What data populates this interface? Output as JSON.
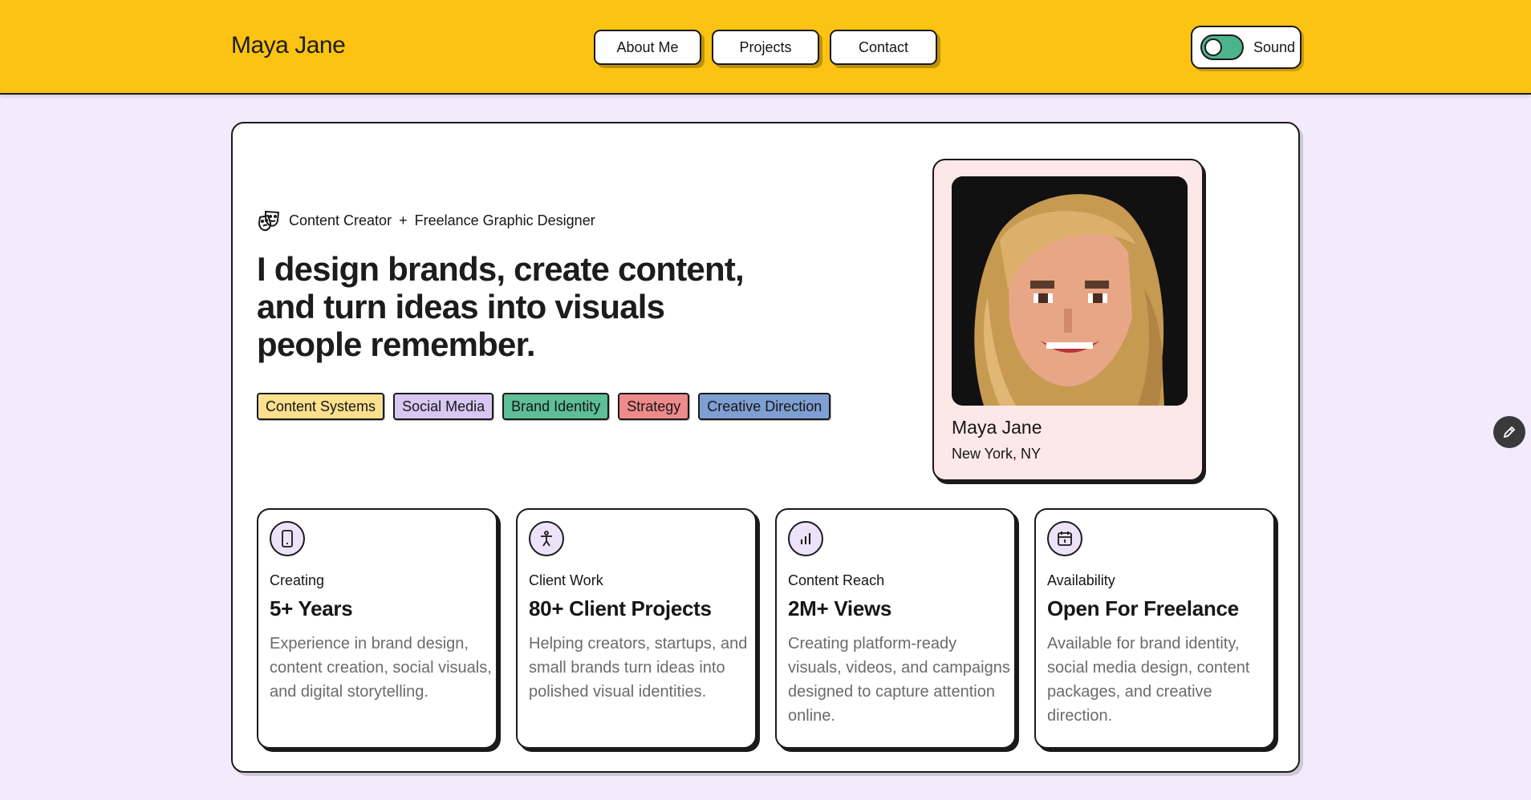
{
  "header": {
    "brand": "Maya Jane",
    "nav": [
      {
        "label": "About Me"
      },
      {
        "label": "Projects"
      },
      {
        "label": "Contact"
      }
    ],
    "sound": {
      "label": "Sound",
      "on": true
    }
  },
  "hero": {
    "role_left": "Content Creator",
    "role_sep": "+",
    "role_right": "Freelance Graphic Designer",
    "headline": "I design brands, create content, and turn ideas into visuals people remember.",
    "tags": [
      {
        "label": "Content Systems",
        "color": "#fbe08e"
      },
      {
        "label": "Social Media",
        "color": "#d8c6f3"
      },
      {
        "label": "Brand Identity",
        "color": "#5ebe97"
      },
      {
        "label": "Strategy",
        "color": "#ef8a8a"
      },
      {
        "label": "Creative Direction",
        "color": "#7f9fd2"
      }
    ]
  },
  "profile": {
    "name": "Maya Jane",
    "location": "New York, NY"
  },
  "stats": [
    {
      "icon": "phone-icon",
      "label": "Creating",
      "value": "5+ Years",
      "desc": "Experience in brand design, content creation, social visuals, and digital storytelling."
    },
    {
      "icon": "accessibility-icon",
      "label": "Client Work",
      "value": "80+ Client Projects",
      "desc": "Helping creators, startups, and small brands turn ideas into polished visual identities."
    },
    {
      "icon": "bar-chart-icon",
      "label": "Content Reach",
      "value": "2M+ Views",
      "desc": "Creating platform-ready visuals, videos, and campaigns designed to capture attention online."
    },
    {
      "icon": "calendar-icon",
      "label": "Availability",
      "value": "Open For Freelance",
      "desc": "Available for brand identity, social media design, content packages, and creative direction."
    }
  ],
  "colors": {
    "header": "#fcc312",
    "background": "#f3eafc",
    "toggle": "#4cb48c"
  }
}
